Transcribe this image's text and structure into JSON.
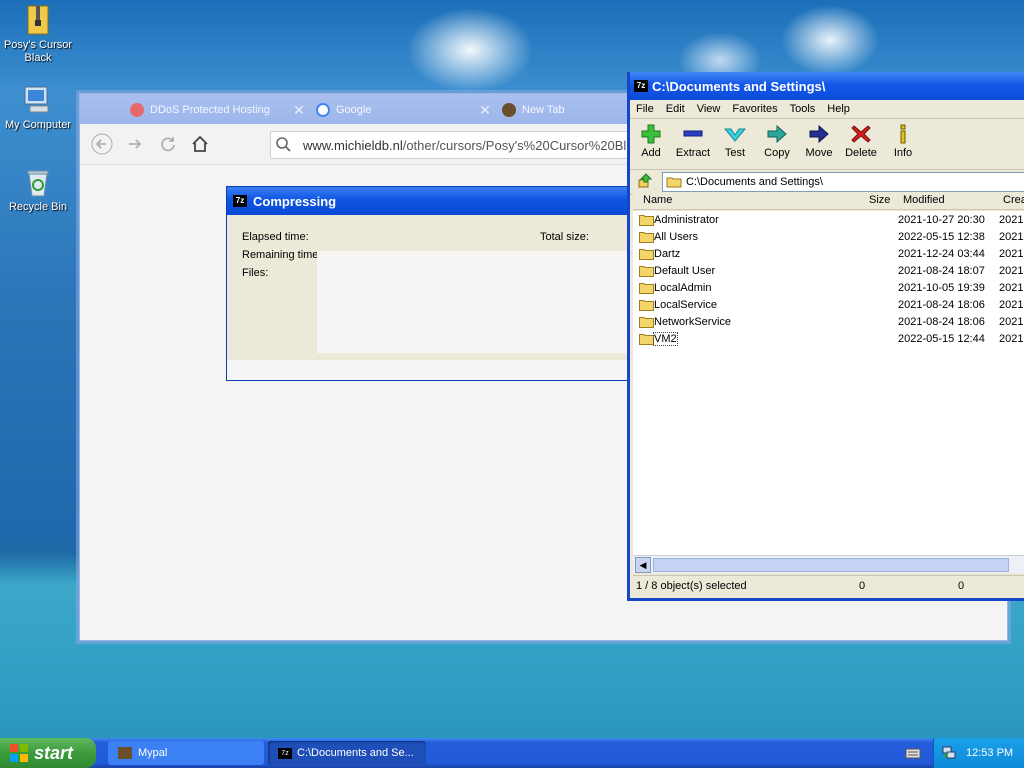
{
  "desktop": {
    "icons": [
      {
        "label": "Posy's Cursor Black"
      },
      {
        "label": "My Computer"
      },
      {
        "label": "Recycle Bin"
      }
    ]
  },
  "browser": {
    "tabs": [
      {
        "title": "DDoS Protected Hosting"
      },
      {
        "title": "Google"
      },
      {
        "title": "New Tab"
      }
    ],
    "url_host": "www.michieldb.nl",
    "url_path": "/other/cursors/Posy's%20Cursor%20Bl"
  },
  "compress_dialog": {
    "title": "Compressing",
    "elapsed_label": "Elapsed time:",
    "remaining_label": "Remaining time:",
    "files_label": "Files:",
    "total_size_label": "Total size:"
  },
  "sevenzip": {
    "title": "C:\\Documents and Settings\\",
    "menu": [
      "File",
      "Edit",
      "View",
      "Favorites",
      "Tools",
      "Help"
    ],
    "tools": [
      "Add",
      "Extract",
      "Test",
      "Copy",
      "Move",
      "Delete",
      "Info"
    ],
    "address": "C:\\Documents and Settings\\",
    "columns": [
      "Name",
      "Size",
      "Modified",
      "Crea"
    ],
    "rows": [
      {
        "name": "Administrator",
        "modified": "2021-10-27 20:30",
        "created": "2021-"
      },
      {
        "name": "All Users",
        "modified": "2022-05-15 12:38",
        "created": "2021-"
      },
      {
        "name": "Dartz",
        "modified": "2021-12-24 03:44",
        "created": "2021-"
      },
      {
        "name": "Default User",
        "modified": "2021-08-24 18:07",
        "created": "2021-"
      },
      {
        "name": "LocalAdmin",
        "modified": "2021-10-05 19:39",
        "created": "2021-"
      },
      {
        "name": "LocalService",
        "modified": "2021-08-24 18:06",
        "created": "2021-"
      },
      {
        "name": "NetworkService",
        "modified": "2021-08-24 18:06",
        "created": "2021-"
      },
      {
        "name": "VM2",
        "modified": "2022-05-15 12:44",
        "created": "2021-"
      }
    ],
    "status": {
      "selection": "1 / 8 object(s) selected",
      "size": "0",
      "packed": "0"
    }
  },
  "taskbar": {
    "start_label": "start",
    "tasks": [
      {
        "label": "Mypal"
      },
      {
        "label": "C:\\Documents and Se..."
      }
    ],
    "clock": "12:53 PM"
  },
  "colors": {
    "xp_blue": "#0a4bd5",
    "start_green": "#3c9a3c"
  }
}
